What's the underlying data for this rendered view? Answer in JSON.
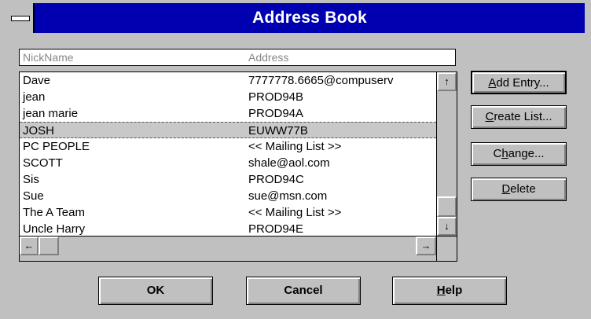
{
  "window": {
    "title": "Address Book"
  },
  "table": {
    "headers": {
      "nickname": "NickName",
      "address": "Address"
    },
    "rows": [
      {
        "nickname": "Dave",
        "address": "7777778.6665@compuserv"
      },
      {
        "nickname": "jean",
        "address": "PROD94B"
      },
      {
        "nickname": "jean marie",
        "address": "PROD94A"
      },
      {
        "nickname": "JOSH",
        "address": "EUWW77B",
        "selected": true
      },
      {
        "nickname": "PC PEOPLE",
        "address": "<< Mailing List >>"
      },
      {
        "nickname": "SCOTT",
        "address": "shale@aol.com"
      },
      {
        "nickname": "Sis",
        "address": "PROD94C"
      },
      {
        "nickname": "Sue",
        "address": "sue@msn.com"
      },
      {
        "nickname": "The A Team",
        "address": "<< Mailing List >>"
      },
      {
        "nickname": "Uncle Harry",
        "address": "PROD94E"
      }
    ]
  },
  "scrollbar": {
    "up_icon": "arrow-up-icon",
    "down_icon": "arrow-down-icon",
    "left_icon": "arrow-left-icon",
    "right_icon": "arrow-right-icon"
  },
  "buttons": {
    "add_entry": {
      "mnemonic": "A",
      "rest": "dd Entry..."
    },
    "create_list": {
      "mnemonic": "C",
      "rest": "reate List..."
    },
    "change": {
      "pre": "C",
      "mnemonic": "h",
      "rest": "ange..."
    },
    "delete": {
      "mnemonic": "D",
      "rest": "elete"
    },
    "ok": "OK",
    "cancel": "Cancel",
    "help": {
      "mnemonic": "H",
      "rest": "elp"
    }
  }
}
